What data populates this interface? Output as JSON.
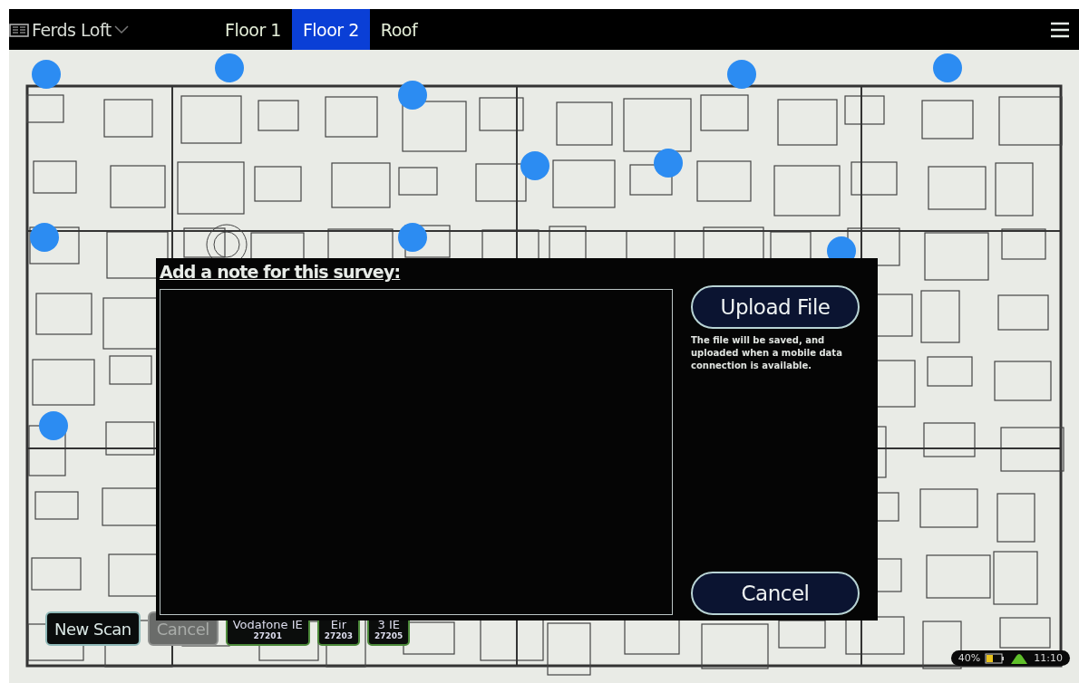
{
  "top_bar": {
    "building": "Ferds Loft",
    "floors": [
      {
        "label": "Floor 1",
        "selected": false
      },
      {
        "label": "Floor 2",
        "selected": true
      },
      {
        "label": "Roof",
        "selected": false
      }
    ]
  },
  "dialog": {
    "title": "Add a note for this survey:",
    "upload_button": "Upload File",
    "upload_hint": "The file will be saved, and uploaded when a mobile data connection is available.",
    "cancel_button": "Cancel"
  },
  "bottom_bar": {
    "actions": [
      {
        "label": "New Scan",
        "disabled": false
      },
      {
        "label": "Cancel",
        "disabled": true
      }
    ],
    "networks": [
      {
        "name": "Vodafone IE",
        "code": "27201"
      },
      {
        "name": "Eir",
        "code": "27203"
      },
      {
        "name": "3 IE",
        "code": "27205"
      }
    ]
  },
  "status": {
    "battery": "40%",
    "time": "11:10"
  }
}
